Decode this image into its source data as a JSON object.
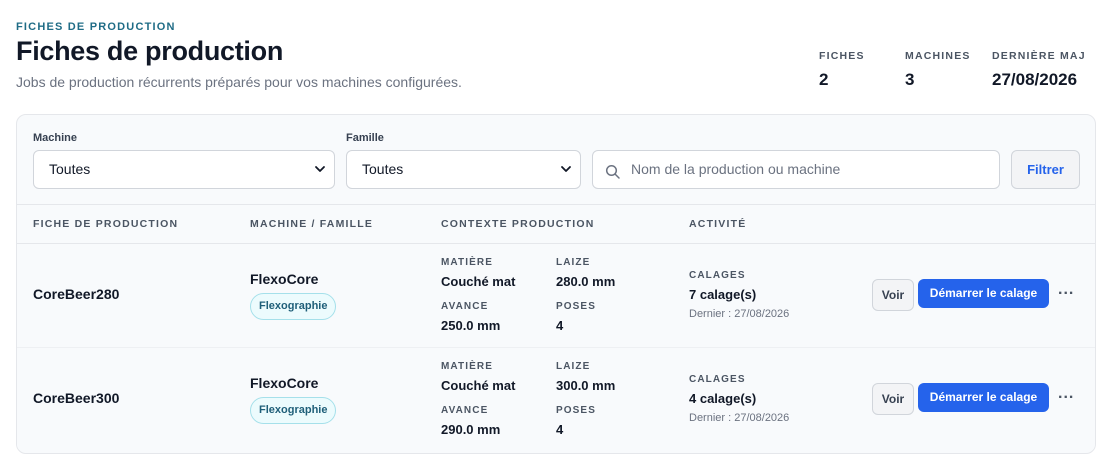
{
  "header": {
    "eyebrow": "FICHES DE PRODUCTION",
    "title": "Fiches de production",
    "subtitle": "Jobs de production récurrents préparés pour vos machines configurées."
  },
  "stats": [
    {
      "label": "FICHES",
      "value": "2"
    },
    {
      "label": "MACHINES",
      "value": "3"
    },
    {
      "label": "DERNIÈRE MAJ",
      "value": "27/08/2026"
    }
  ],
  "filters": {
    "machine_label": "Machine",
    "machine_value": "Toutes",
    "famille_label": "Famille",
    "famille_value": "Toutes",
    "search_placeholder": "Nom de la production ou machine",
    "filter_button": "Filtrer"
  },
  "table": {
    "columns": [
      "FICHE DE PRODUCTION",
      "MACHINE / FAMILLE",
      "CONTEXTE PRODUCTION",
      "ACTIVITÉ"
    ],
    "rows": [
      {
        "name": "CoreBeer280",
        "machine": "FlexoCore",
        "famille": "Flexographie",
        "matiere_label": "MATIÈRE",
        "matiere": "Couché mat",
        "laize_label": "LAIZE",
        "laize": "280.0 mm",
        "avance_label": "AVANCE",
        "avance": "250.0 mm",
        "poses_label": "POSES",
        "poses": "4",
        "calages_label": "CALAGES",
        "calages": "7 calage(s)",
        "dernier": "Dernier : 27/08/2026",
        "voir": "Voir",
        "start": "Démarrer le calage",
        "more": "..."
      },
      {
        "name": "CoreBeer300",
        "machine": "FlexoCore",
        "famille": "Flexographie",
        "matiere_label": "MATIÈRE",
        "matiere": "Couché mat",
        "laize_label": "LAIZE",
        "laize": "300.0 mm",
        "avance_label": "AVANCE",
        "avance": "290.0 mm",
        "poses_label": "POSES",
        "poses": "4",
        "calages_label": "CALAGES",
        "calages": "4 calage(s)",
        "dernier": "Dernier : 27/08/2026",
        "voir": "Voir",
        "start": "Démarrer le calage",
        "more": "..."
      }
    ]
  },
  "colors": {
    "accent": "#2563eb",
    "eyebrow": "#1f6c86",
    "badge_bg": "#ecfbfd",
    "badge_border": "#a5e0ea"
  },
  "icons": {
    "search": "search-icon",
    "select_chevron": "chevron-down-icon"
  }
}
